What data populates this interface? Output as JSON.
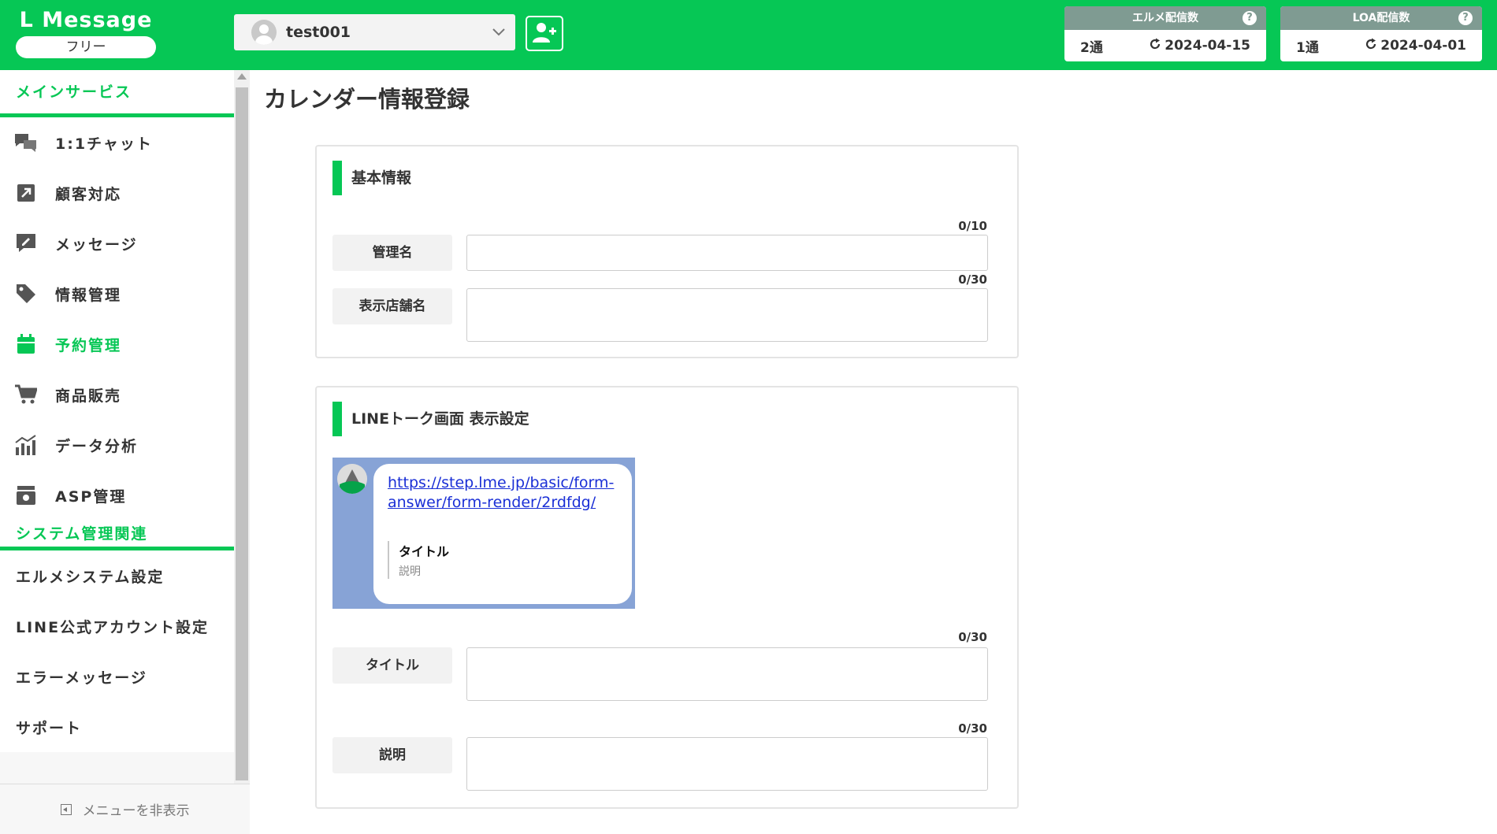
{
  "header": {
    "logo_title": "L Message",
    "plan_label": "フリー",
    "account_name": "test001",
    "elme_count": {
      "title": "エルメ配信数",
      "count": "2通",
      "date": "2024-04-15"
    },
    "loa_count": {
      "title": "LOA配信数",
      "count": "1通",
      "date": "2024-04-01"
    },
    "help_symbol": "?"
  },
  "sidebar": {
    "main_section_title": "メインサービス",
    "main_items": [
      {
        "label": "1:1チャット",
        "icon": "chat-icon"
      },
      {
        "label": "顧客対応",
        "icon": "arrow-out-icon"
      },
      {
        "label": "メッセージ",
        "icon": "message-edit-icon"
      },
      {
        "label": "情報管理",
        "icon": "tag-icon"
      },
      {
        "label": "予約管理",
        "icon": "calendar-icon",
        "active": true
      },
      {
        "label": "商品販売",
        "icon": "cart-icon"
      },
      {
        "label": "データ分析",
        "icon": "analytics-icon"
      },
      {
        "label": "ASP管理",
        "icon": "asp-box-icon"
      }
    ],
    "system_section_title": "システム管理関連",
    "system_items": [
      {
        "label": "エルメシステム設定"
      },
      {
        "label": "LINE公式アカウント設定"
      },
      {
        "label": "エラーメッセージ"
      },
      {
        "label": "サポート"
      }
    ],
    "hide_menu_label": "メニューを非表示"
  },
  "main": {
    "page_title": "カレンダー情報登録",
    "basic_info": {
      "heading": "基本情報",
      "admin_name": {
        "label": "管理名",
        "value": "",
        "count": "0/10"
      },
      "store_name": {
        "label": "表示店舗名",
        "value": "",
        "count": "0/30"
      }
    },
    "line_talk": {
      "heading": "LINEトーク画面 表示設定",
      "preview": {
        "link_line1": "https://step.lme.jp/basic/form-",
        "link_line2": "answer/form-render/2rdfdg/",
        "card_title": "タイトル",
        "card_desc": "説明"
      },
      "title_field": {
        "label": "タイトル",
        "value": "",
        "count": "0/30"
      },
      "desc_field": {
        "label": "説明",
        "value": "",
        "count": "0/30"
      }
    }
  },
  "colors": {
    "brand": "#06c755",
    "count_header": "#7f9b92",
    "preview_bg": "#87a3d6"
  }
}
